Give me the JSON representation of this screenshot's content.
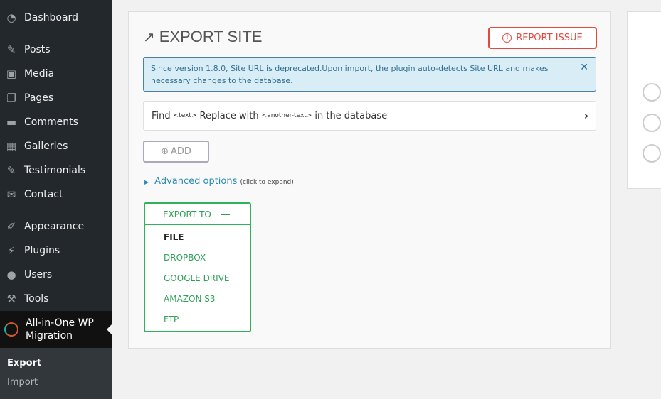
{
  "sidebar": {
    "items": [
      {
        "label": "Dashboard",
        "icon": "dashboard-icon"
      },
      {
        "label": "Posts",
        "icon": "pin-icon"
      },
      {
        "label": "Media",
        "icon": "media-icon"
      },
      {
        "label": "Pages",
        "icon": "pages-icon"
      },
      {
        "label": "Comments",
        "icon": "comment-icon"
      },
      {
        "label": "Galleries",
        "icon": "grid-icon"
      },
      {
        "label": "Testimonials",
        "icon": "pin-icon"
      },
      {
        "label": "Contact",
        "icon": "mail-icon"
      },
      {
        "label": "Appearance",
        "icon": "brush-icon"
      },
      {
        "label": "Plugins",
        "icon": "plug-icon"
      },
      {
        "label": "Users",
        "icon": "user-icon"
      },
      {
        "label": "Tools",
        "icon": "wrench-icon"
      }
    ],
    "active": {
      "label": "All-in-One WP Migration",
      "icon": "migration-icon"
    },
    "submenu": [
      "Export",
      "Import"
    ]
  },
  "main": {
    "title": "EXPORT SITE",
    "report_label": "REPORT ISSUE",
    "notice": "Since version 1.8.0, Site URL is deprecated.Upon import, the plugin auto-detects Site URL and makes necessary changes to the database.",
    "find": {
      "a": "Find",
      "b": "<text>",
      "c": "Replace with",
      "d": "<another-text>",
      "e": "in the database"
    },
    "add_label": "ADD",
    "advanced": {
      "label": "Advanced options",
      "hint": "(click to expand)"
    },
    "export_to": {
      "label": "EXPORT TO",
      "options": [
        "FILE",
        "DROPBOX",
        "GOOGLE DRIVE",
        "AMAZON S3",
        "FTP"
      ]
    }
  },
  "colors": {
    "accent_green": "#2fb35a",
    "report_red": "#e04b3f",
    "notice_bg": "#d9edf7",
    "sidebar_bg": "#23282d"
  }
}
